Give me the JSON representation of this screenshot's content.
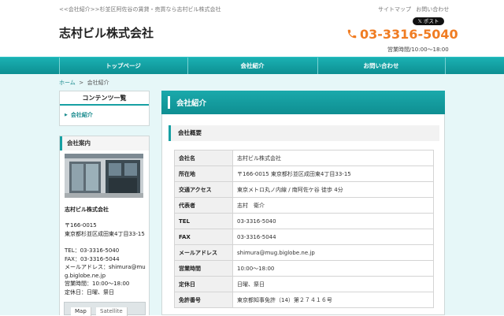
{
  "header": {
    "tagline": "<<会社紹介>>杉並区阿佐谷の賃貸・売買なら志村ビル株式会社",
    "site_title": "志村ビル株式会社",
    "util_links": [
      "サイトマップ",
      "お問い合わせ"
    ],
    "post_button": "ポスト",
    "phone": "03-3316-5040",
    "hours": "営業時間/10:00～18:00"
  },
  "nav": {
    "items": [
      "トップページ",
      "会社紹介",
      "お問い合わせ"
    ]
  },
  "breadcrumb": {
    "home": "ホーム",
    "separator": ">",
    "current": "会社紹介"
  },
  "sidebar": {
    "contents_title": "コンテンツ一覧",
    "contents_items": [
      "会社紹介"
    ],
    "info_title": "会社案内",
    "company_name": "志村ビル株式会社",
    "postal": "〒166-0015",
    "address": "東京都杉並区成田東4丁目33-15",
    "tel": "TEL：03-3316-5040",
    "fax": "FAX：03-3316-5044",
    "mail_line1": "メールアドレス：shimura@mu",
    "mail_line2": "g.biglobe.ne.jp",
    "hours": "営業時間：10:00～18:00",
    "holidays": "定休日：日曜、祭日",
    "map_tabs": [
      "Map",
      "Satellite"
    ]
  },
  "main": {
    "title": "会社紹介",
    "section_title": "会社概要",
    "rows": [
      {
        "label": "会社名",
        "value": "志村ビル株式会社"
      },
      {
        "label": "所在地",
        "value": "〒166-0015 東京都杉並区成田東4丁目33-15"
      },
      {
        "label": "交通アクセス",
        "value": "東京メトロ丸ノ内線 / 南阿佐ケ谷 徒歩 4分"
      },
      {
        "label": "代表者",
        "value": "志村　衛介"
      },
      {
        "label": "TEL",
        "value": "03-3316-5040"
      },
      {
        "label": "FAX",
        "value": "03-3316-5044"
      },
      {
        "label": "メールアドレス",
        "value": "shimura@mug.biglobe.ne.jp"
      },
      {
        "label": "営業時間",
        "value": "10:00～18:00"
      },
      {
        "label": "定休日",
        "value": "日曜、祭日"
      },
      {
        "label": "免許番号",
        "value": "東京都知事免許（14）第２７４１６号"
      }
    ]
  },
  "colors": {
    "accent": "#17a0a3",
    "phone": "#f07c22",
    "background": "#e6f7f8"
  }
}
